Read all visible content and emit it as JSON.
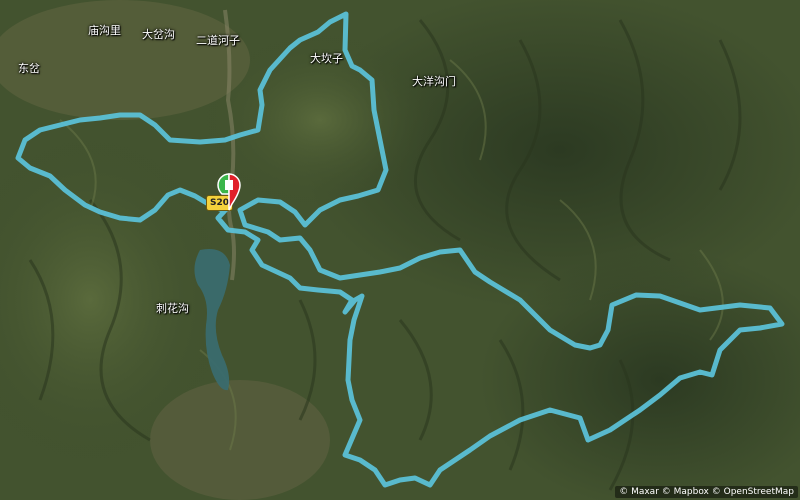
{
  "map": {
    "route_color": "#5bc0d6",
    "water_color": "#3a6b6e",
    "places": [
      {
        "id": "miaogouli",
        "label": "庙沟里"
      },
      {
        "id": "dachagou",
        "label": "大岔沟"
      },
      {
        "id": "erdaohezi",
        "label": "二道河子"
      },
      {
        "id": "dongcha",
        "label": "东岔"
      },
      {
        "id": "dakanzi",
        "label": "大坎子"
      },
      {
        "id": "dayanggoumen",
        "label": "大洋沟门"
      },
      {
        "id": "cihuagou",
        "label": "刺花沟"
      }
    ],
    "road_label": "S20",
    "start_marker": "start-finish-marker-icon",
    "attribution": "© Maxar © Mapbox © OpenStreetMap"
  }
}
